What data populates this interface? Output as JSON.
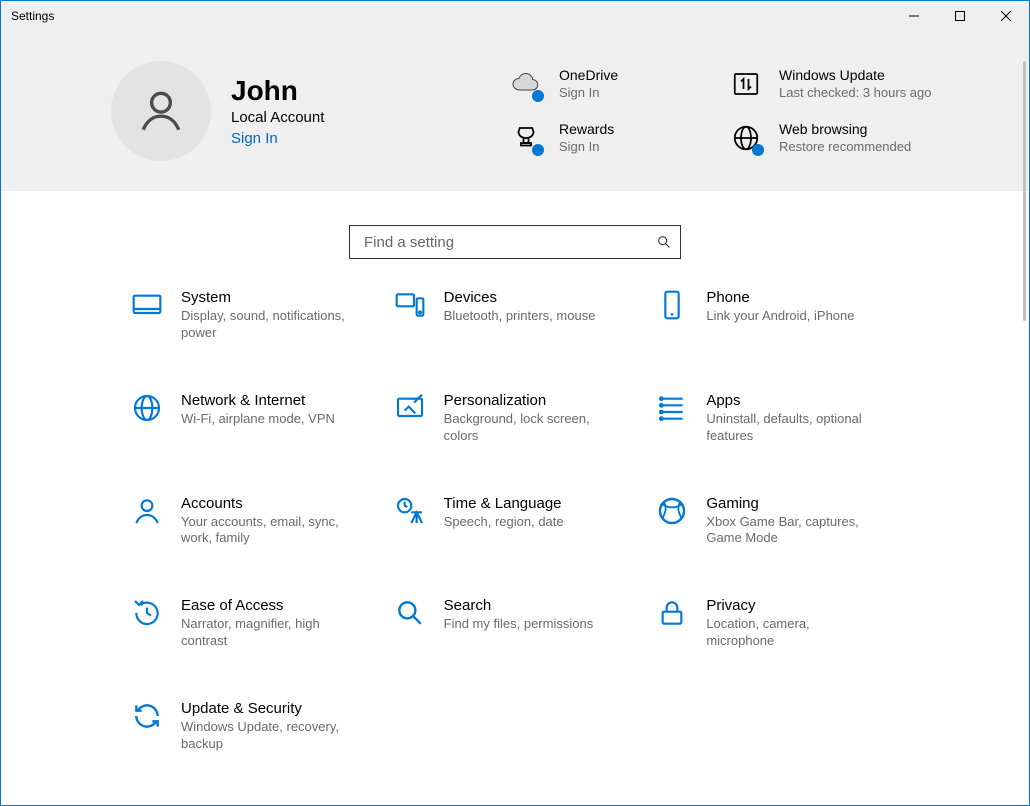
{
  "window": {
    "title": "Settings"
  },
  "user": {
    "name": "John",
    "accountType": "Local Account",
    "signInLabel": "Sign In"
  },
  "status": {
    "onedrive": {
      "title": "OneDrive",
      "sub": "Sign In"
    },
    "update": {
      "title": "Windows Update",
      "sub": "Last checked: 3 hours ago"
    },
    "rewards": {
      "title": "Rewards",
      "sub": "Sign In"
    },
    "web": {
      "title": "Web browsing",
      "sub": "Restore recommended"
    }
  },
  "search": {
    "placeholder": "Find a setting"
  },
  "categories": [
    {
      "key": "system",
      "title": "System",
      "sub": "Display, sound, notifications, power"
    },
    {
      "key": "devices",
      "title": "Devices",
      "sub": "Bluetooth, printers, mouse"
    },
    {
      "key": "phone",
      "title": "Phone",
      "sub": "Link your Android, iPhone"
    },
    {
      "key": "network",
      "title": "Network & Internet",
      "sub": "Wi-Fi, airplane mode, VPN"
    },
    {
      "key": "personalization",
      "title": "Personalization",
      "sub": "Background, lock screen, colors"
    },
    {
      "key": "apps",
      "title": "Apps",
      "sub": "Uninstall, defaults, optional features"
    },
    {
      "key": "accounts",
      "title": "Accounts",
      "sub": "Your accounts, email, sync, work, family"
    },
    {
      "key": "time",
      "title": "Time & Language",
      "sub": "Speech, region, date"
    },
    {
      "key": "gaming",
      "title": "Gaming",
      "sub": "Xbox Game Bar, captures, Game Mode"
    },
    {
      "key": "ease",
      "title": "Ease of Access",
      "sub": "Narrator, magnifier, high contrast"
    },
    {
      "key": "search",
      "title": "Search",
      "sub": "Find my files, permissions"
    },
    {
      "key": "privacy",
      "title": "Privacy",
      "sub": "Location, camera, microphone"
    },
    {
      "key": "updatesec",
      "title": "Update & Security",
      "sub": "Windows Update, recovery, backup"
    }
  ]
}
